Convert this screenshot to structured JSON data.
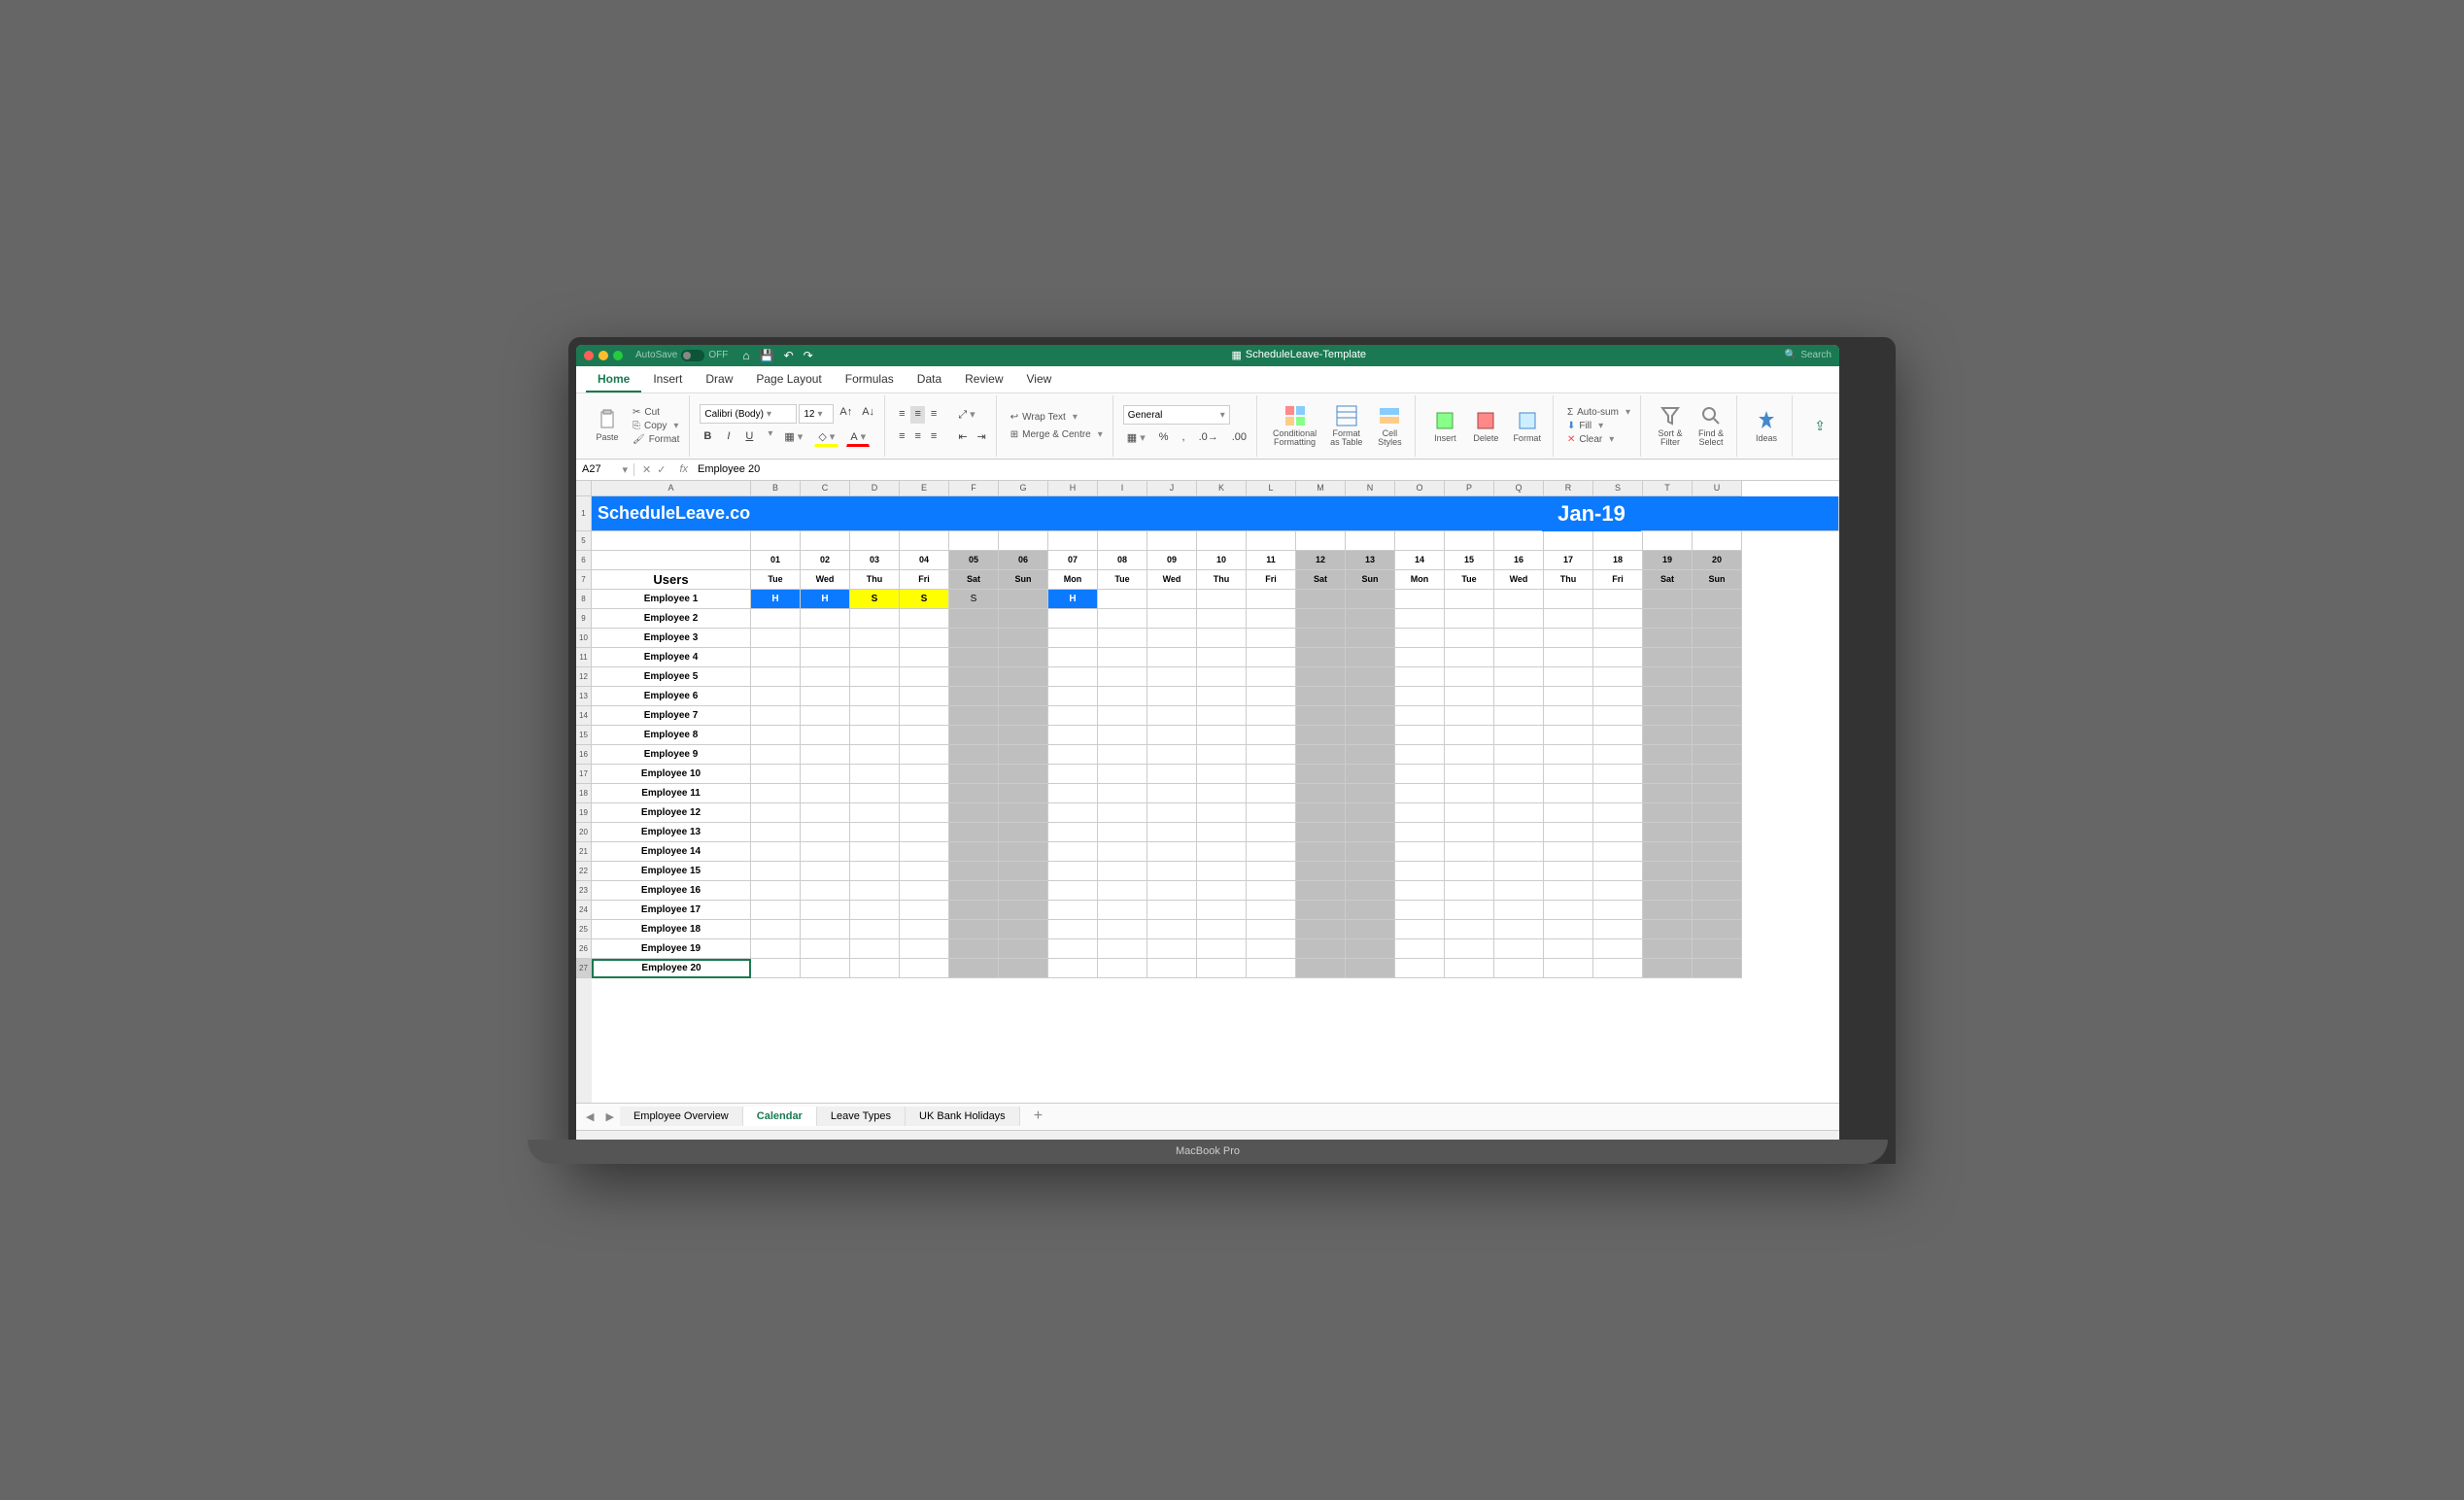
{
  "window": {
    "title": "ScheduleLeave-Template",
    "autosave": "AutoSave",
    "autosave_state": "OFF",
    "search": "Search",
    "brand": "MacBook Pro"
  },
  "tabs": [
    "Home",
    "Insert",
    "Draw",
    "Page Layout",
    "Formulas",
    "Data",
    "Review",
    "View"
  ],
  "active_tab": "Home",
  "ribbon": {
    "paste": "Paste",
    "cut": "Cut",
    "copy": "Copy",
    "format_p": "Format",
    "font_name": "Calibri (Body)",
    "font_size": "12",
    "bold": "B",
    "italic": "I",
    "underline": "U",
    "wrap": "Wrap Text",
    "merge": "Merge & Centre",
    "num_format": "General",
    "cond": "Conditional\nFormatting",
    "fmt_table": "Format\nas Table",
    "cell_styles": "Cell\nStyles",
    "insert": "Insert",
    "delete": "Delete",
    "format": "Format",
    "autosum": "Auto-sum",
    "fill": "Fill",
    "clear": "Clear",
    "sortfilter": "Sort &\nFilter",
    "findselect": "Find &\nSelect",
    "ideas": "Ideas"
  },
  "formula_bar": {
    "name": "A27",
    "value": "Employee 20"
  },
  "columns": [
    "A",
    "B",
    "C",
    "D",
    "E",
    "F",
    "G",
    "H",
    "I",
    "J",
    "K",
    "L",
    "M",
    "N",
    "O",
    "P",
    "Q",
    "R",
    "S",
    "T",
    "U"
  ],
  "banner": {
    "title": "ScheduleLeave.com",
    "month": "Jan-19"
  },
  "dates": [
    "01",
    "02",
    "03",
    "04",
    "05",
    "06",
    "07",
    "08",
    "09",
    "10",
    "11",
    "12",
    "13",
    "14",
    "15",
    "16",
    "17",
    "18",
    "19",
    "20"
  ],
  "days": [
    "Tue",
    "Wed",
    "Thu",
    "Fri",
    "Sat",
    "Sun",
    "Mon",
    "Tue",
    "Wed",
    "Thu",
    "Fri",
    "Sat",
    "Sun",
    "Mon",
    "Tue",
    "Wed",
    "Thu",
    "Fri",
    "Sat",
    "Sun"
  ],
  "weekends": [
    4,
    5,
    11,
    12,
    18,
    19
  ],
  "users_header": "Users",
  "employees": [
    "Employee 1",
    "Employee 2",
    "Employee 3",
    "Employee 4",
    "Employee 5",
    "Employee 6",
    "Employee 7",
    "Employee 8",
    "Employee 9",
    "Employee 10",
    "Employee 11",
    "Employee 12",
    "Employee 13",
    "Employee 14",
    "Employee 15",
    "Employee 16",
    "Employee 17",
    "Employee 18",
    "Employee 19",
    "Employee 20"
  ],
  "leave": {
    "0": {
      "0": "H",
      "1": "H",
      "2": "S",
      "3": "S",
      "4": "S",
      "6": "H"
    }
  },
  "row_nums_left": [
    "1",
    "5",
    "6",
    "7",
    "8",
    "9",
    "10",
    "11",
    "12",
    "13",
    "14",
    "15",
    "16",
    "17",
    "18",
    "19",
    "20",
    "21",
    "22",
    "23",
    "24",
    "25",
    "26",
    "27"
  ],
  "sheet_tabs": [
    "Employee Overview",
    "Calendar",
    "Leave Types",
    "UK Bank Holidays"
  ],
  "active_sheet": "Calendar"
}
